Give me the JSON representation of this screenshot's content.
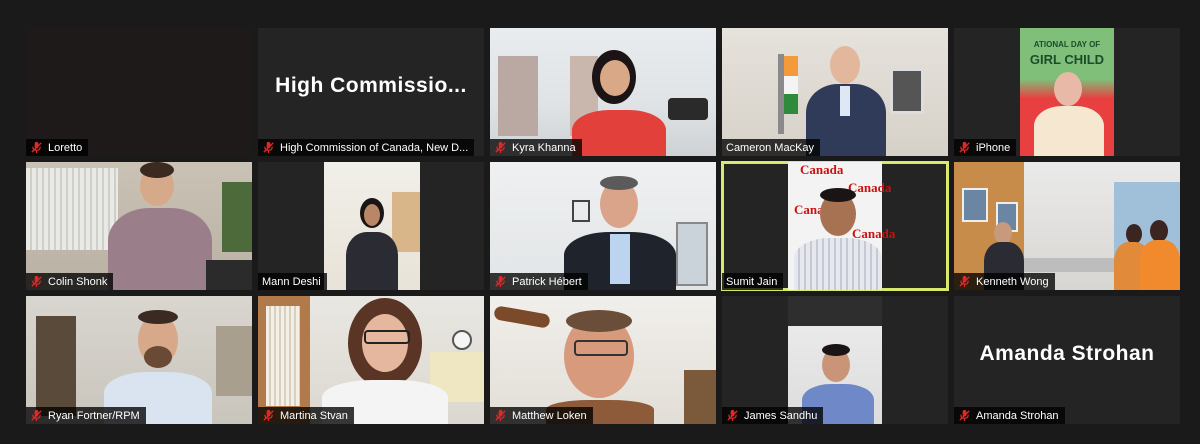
{
  "participants": [
    {
      "name": "Loretto",
      "muted": true
    },
    {
      "name": "High Commission of Canada, New D...",
      "muted": true,
      "display_name": "High  Commissio..."
    },
    {
      "name": "Kyra Khanna",
      "muted": true
    },
    {
      "name": "Cameron MacKay",
      "muted": false
    },
    {
      "name": "iPhone",
      "muted": true,
      "poster_line1": "ATIONAL DAY OF",
      "poster_line2": "GIRL CHILD"
    },
    {
      "name": "Colin Shonk",
      "muted": true
    },
    {
      "name": "Mann Deshi",
      "muted": false
    },
    {
      "name": "Patrick Hébert",
      "muted": true
    },
    {
      "name": "Sumit Jain",
      "muted": false,
      "active_speaker": true,
      "backdrop_text": "Canada"
    },
    {
      "name": "Kenneth Wong",
      "muted": true
    },
    {
      "name": "Ryan Fortner/RPM",
      "muted": true
    },
    {
      "name": "Martina Stvan",
      "muted": true
    },
    {
      "name": "Matthew Loken",
      "muted": true
    },
    {
      "name": "James Sandhu",
      "muted": true
    },
    {
      "name": "Amanda Strohan",
      "muted": true,
      "display_name": "Amanda Strohan"
    }
  ],
  "colors": {
    "background": "#1a1a1a",
    "tile": "#242424",
    "active_border": "#d8e96b",
    "muted_icon": "#e02828"
  },
  "icons": {
    "muted": "microphone-muted-icon"
  }
}
